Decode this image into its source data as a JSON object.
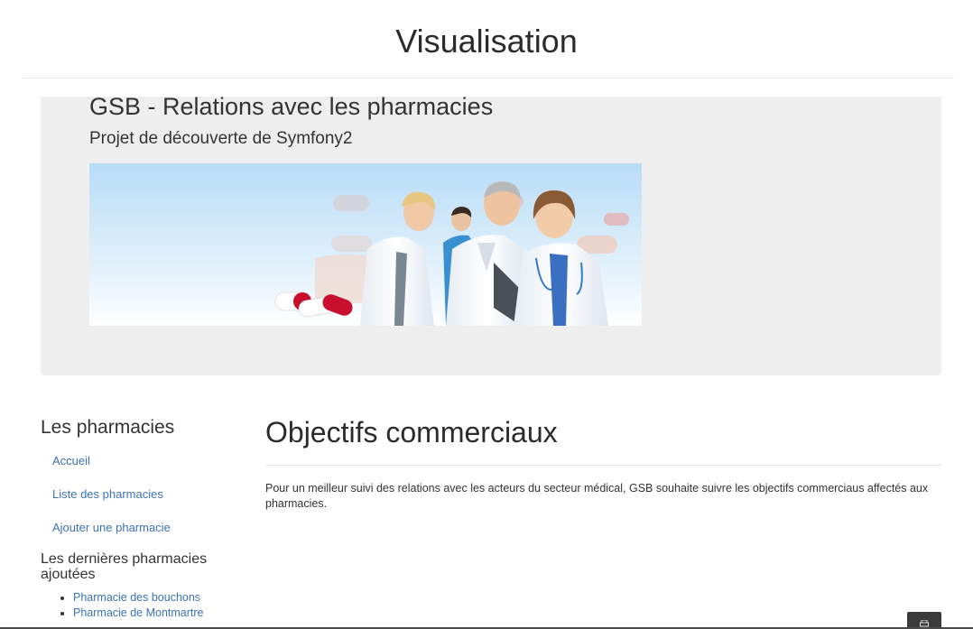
{
  "page": {
    "title": "Visualisation"
  },
  "jumbotron": {
    "title": "GSB - Relations avec les pharmacies",
    "subtitle": "Projet de découverte de Symfony2"
  },
  "sidebar": {
    "heading": "Les pharmacies",
    "links": [
      {
        "label": "Accueil"
      },
      {
        "label": "Liste des pharmacies"
      },
      {
        "label": "Ajouter une pharmacie"
      }
    ],
    "recent_heading": "Les dernières pharmacies ajoutées",
    "recent_items": [
      {
        "label": "Pharmacie des bouchons"
      },
      {
        "label": "Pharmacie de Montmartre"
      }
    ]
  },
  "main": {
    "heading": "Objectifs commerciaux",
    "text": "Pour un meilleur suivi des relations avec les acteurs du secteur médical, GSB souhaite suivre les objectifs commerciaus affectés aux pharmacies."
  },
  "colors": {
    "link": "#3a73b5",
    "jumbotron_bg": "#eeeeee",
    "text": "#333333"
  },
  "icons": {
    "print": "print-icon"
  }
}
